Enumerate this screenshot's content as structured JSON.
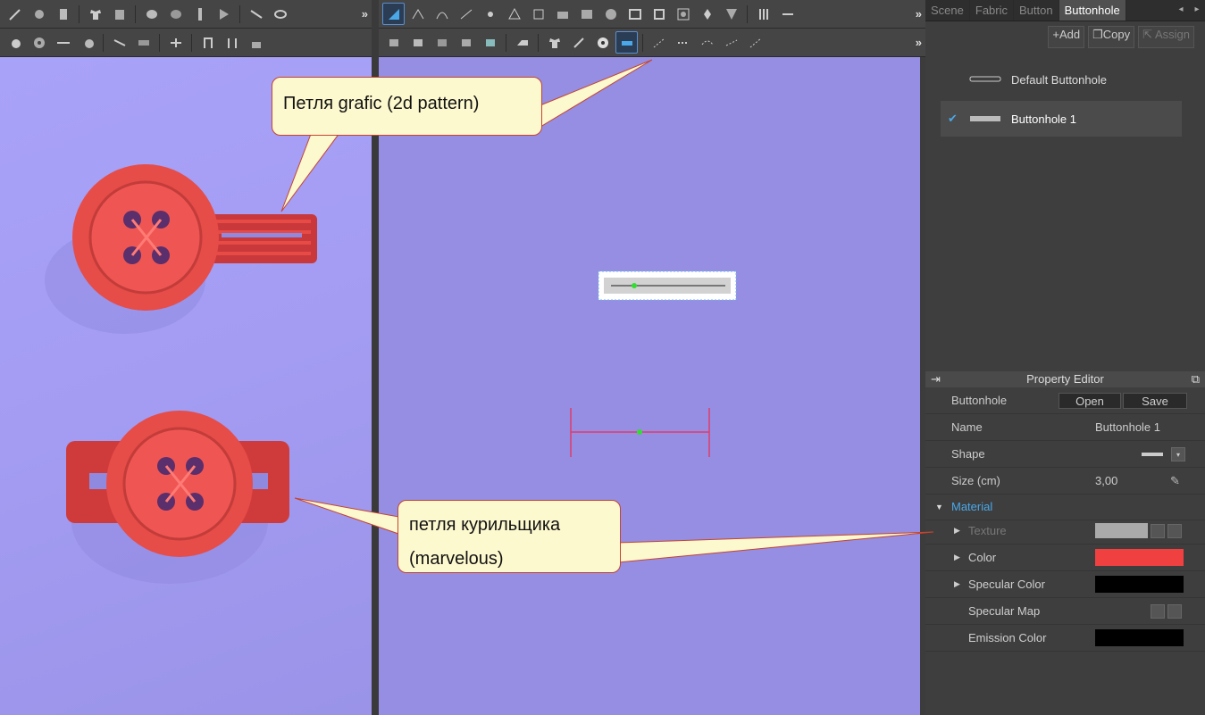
{
  "right_panel": {
    "tabs": [
      {
        "label": "Scene"
      },
      {
        "label": "Fabric"
      },
      {
        "label": "Button"
      },
      {
        "label": "Buttonhole"
      }
    ],
    "actions": {
      "add": "Add",
      "copy": "Copy",
      "assign": "Assign"
    },
    "library": [
      {
        "label": "Default Buttonhole"
      },
      {
        "label": "Buttonhole 1"
      }
    ],
    "property_editor": {
      "title": "Property Editor",
      "buttonhole_label": "Buttonhole",
      "open_label": "Open",
      "save_label": "Save",
      "name_label": "Name",
      "name_value": "Buttonhole 1",
      "shape_label": "Shape",
      "size_label": "Size (cm)",
      "size_value": "3,00",
      "material_label": "Material",
      "texture_label": "Texture",
      "color_label": "Color",
      "color_value": "#f04040",
      "specular_color_label": "Specular Color",
      "specular_color_value": "#000000",
      "specular_map_label": "Specular Map",
      "emission_color_label": "Emission Color",
      "emission_color_value": "#000000"
    }
  },
  "annotations": {
    "top_callout": "Петля grafic (2d pattern)",
    "bottom_callout_line1": "петля курильщика",
    "bottom_callout_line2": "(marvelous)"
  },
  "colors": {
    "button_red": "#f0524f",
    "callout_fill": "#fdf9cf",
    "callout_border": "#c5432f",
    "viewport_3d": "#a39cf2",
    "viewport_2d": "#958ee2",
    "accent": "#4aa8e8"
  },
  "toolbar_icons": [
    "brush-icon",
    "pin-icon",
    "tack-icon",
    "shirt-icon",
    "fold-icon",
    "layer-icon",
    "stack-icon",
    "select-icon",
    "polygon-icon",
    "curve-icon",
    "rectangle-icon",
    "circle-icon",
    "sewing-icon",
    "buttonhole-icon",
    "button-icon"
  ]
}
